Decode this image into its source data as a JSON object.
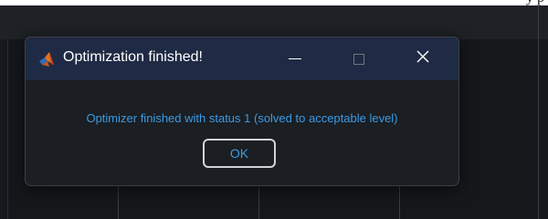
{
  "background_window": {
    "top_fragment_text": "y p"
  },
  "dialog": {
    "title": "Optimization finished!",
    "app_icon": "matlab-icon",
    "controls": {
      "minimize_icon": "minimize-icon",
      "maximize_icon": "maximize-icon",
      "close_icon": "close-icon",
      "close_glyph": "✕"
    },
    "message": "Optimizer finished with status 1 (solved to acceptable level)",
    "ok_label": "OK"
  },
  "colors": {
    "title_bar": "#1f2a44",
    "dialog_background": "#1b1e22",
    "message_text": "#3a9be6",
    "button_text": "#3a9be6"
  }
}
